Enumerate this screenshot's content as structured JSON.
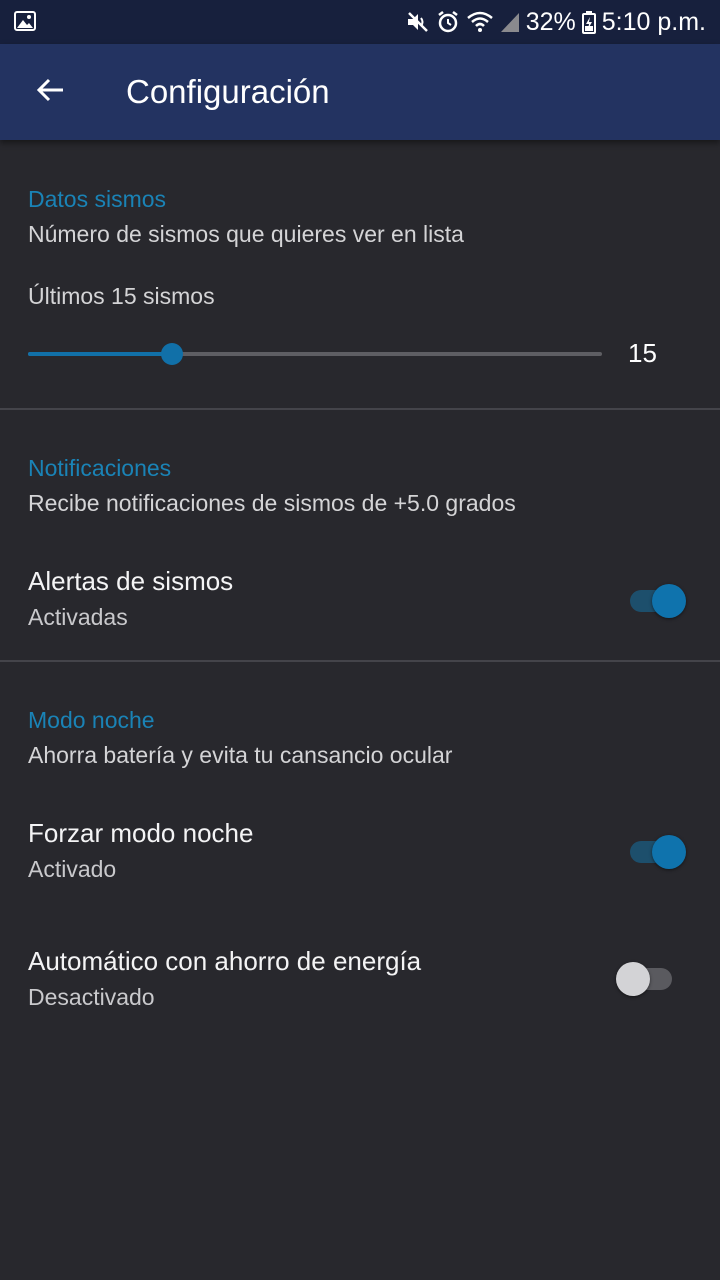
{
  "status_bar": {
    "battery": "32%",
    "time": "5:10 p.m.",
    "icons": [
      "image-icon",
      "mute-icon",
      "alarm-icon",
      "wifi-icon",
      "signal-icon",
      "battery-icon"
    ]
  },
  "app_bar": {
    "title": "Configuración",
    "back_icon": "arrow-back-icon"
  },
  "sections": {
    "datos": {
      "title": "Datos sismos",
      "subtitle": "Número de sismos que quieres ver en lista",
      "slider_label": "Últimos 15 sismos",
      "slider_value": "15",
      "slider_fraction": 0.25
    },
    "notificaciones": {
      "title": "Notificaciones",
      "subtitle": "Recibe notificaciones de sismos de +5.0 grados",
      "alertas": {
        "label": "Alertas de sismos",
        "status": "Activadas",
        "on": true
      }
    },
    "modo_noche": {
      "title": "Modo noche",
      "subtitle": "Ahorra batería y evita tu cansancio ocular",
      "forzar": {
        "label": "Forzar modo noche",
        "status": "Activado",
        "on": true
      },
      "automatico": {
        "label": "Automático con ahorro de energía",
        "status": "Desactivado",
        "on": false
      }
    }
  },
  "colors": {
    "accent": "#1a83b6",
    "app_bar": "#233361",
    "status_bar": "#17203d",
    "background": "#28282d"
  }
}
